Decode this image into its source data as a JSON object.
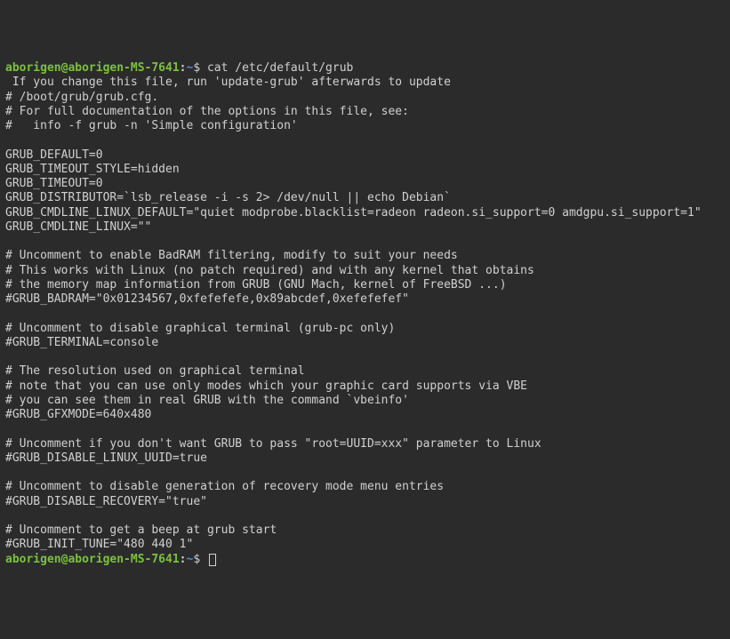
{
  "prompt1": {
    "user_host": "aborigen@aborigen-MS-7641",
    "colon": ":",
    "path": "~",
    "dollar": "$ ",
    "command": "cat /etc/default/grub"
  },
  "output": {
    "l0": " If you change this file, run 'update-grub' afterwards to update",
    "l1": "# /boot/grub/grub.cfg.",
    "l2": "# For full documentation of the options in this file, see:",
    "l3": "#   info -f grub -n 'Simple configuration'",
    "l4": "",
    "l5": "GRUB_DEFAULT=0",
    "l6": "GRUB_TIMEOUT_STYLE=hidden",
    "l7": "GRUB_TIMEOUT=0",
    "l8": "GRUB_DISTRIBUTOR=`lsb_release -i -s 2> /dev/null || echo Debian`",
    "l9": "GRUB_CMDLINE_LINUX_DEFAULT=\"quiet modprobe.blacklist=radeon radeon.si_support=0 amdgpu.si_support=1\"",
    "l10": "GRUB_CMDLINE_LINUX=\"\"",
    "l11": "",
    "l12": "# Uncomment to enable BadRAM filtering, modify to suit your needs",
    "l13": "# This works with Linux (no patch required) and with any kernel that obtains",
    "l14": "# the memory map information from GRUB (GNU Mach, kernel of FreeBSD ...)",
    "l15": "#GRUB_BADRAM=\"0x01234567,0xfefefefe,0x89abcdef,0xefefefef\"",
    "l16": "",
    "l17": "# Uncomment to disable graphical terminal (grub-pc only)",
    "l18": "#GRUB_TERMINAL=console",
    "l19": "",
    "l20": "# The resolution used on graphical terminal",
    "l21": "# note that you can use only modes which your graphic card supports via VBE",
    "l22": "# you can see them in real GRUB with the command `vbeinfo'",
    "l23": "#GRUB_GFXMODE=640x480",
    "l24": "",
    "l25": "# Uncomment if you don't want GRUB to pass \"root=UUID=xxx\" parameter to Linux",
    "l26": "#GRUB_DISABLE_LINUX_UUID=true",
    "l27": "",
    "l28": "# Uncomment to disable generation of recovery mode menu entries",
    "l29": "#GRUB_DISABLE_RECOVERY=\"true\"",
    "l30": "",
    "l31": "# Uncomment to get a beep at grub start",
    "l32": "#GRUB_INIT_TUNE=\"480 440 1\""
  },
  "prompt2": {
    "user_host": "aborigen@aborigen-MS-7641",
    "colon": ":",
    "path": "~",
    "dollar": "$ "
  }
}
